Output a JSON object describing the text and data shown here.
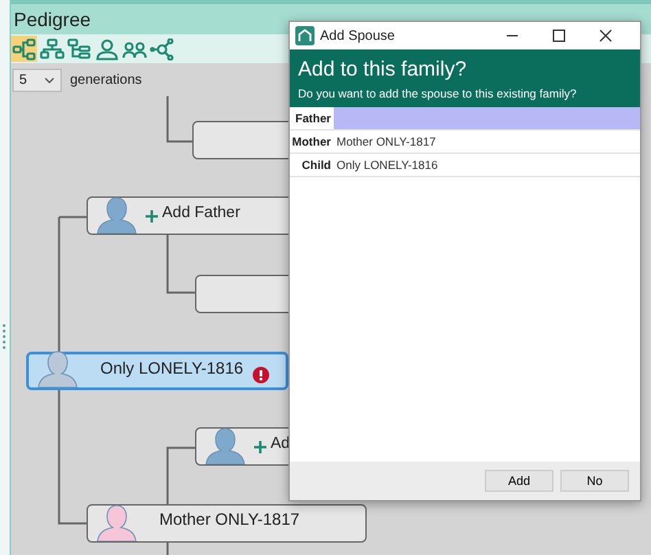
{
  "panel": {
    "title": "Pedigree"
  },
  "tools": [
    {
      "selected": true
    },
    {
      "selected": false
    },
    {
      "selected": false
    },
    {
      "selected": false
    },
    {
      "selected": false
    },
    {
      "selected": false
    }
  ],
  "generations": {
    "value": "5",
    "label": "generations"
  },
  "nodes": [
    {
      "kind": "empty",
      "selected": false
    },
    {
      "kind": "add",
      "label": "Add Father",
      "color": "#7fa9cc",
      "selected": false
    },
    {
      "kind": "empty",
      "selected": false
    },
    {
      "kind": "person",
      "label": "Only LONELY-1816",
      "color": "#b8c8d8",
      "selected": true,
      "warning": true
    },
    {
      "kind": "add",
      "label": "Ad",
      "color": "#7fa9cc",
      "selected": false
    },
    {
      "kind": "person",
      "label": "Mother ONLY-1817",
      "color": "#f6c6d8",
      "selected": false,
      "warning": false
    }
  ],
  "dialog": {
    "title": "Add Spouse",
    "heading": "Add to this family?",
    "subtitle": "Do you want to add the spouse to this existing family?",
    "rows": [
      {
        "label": "Father",
        "selected": true
      },
      {
        "label": "Mother",
        "value": "Mother ONLY-1817",
        "selected": false
      },
      {
        "label": "Child",
        "value": "Only LONELY-1816",
        "selected": false
      }
    ],
    "buttons": [
      "Add",
      "No"
    ]
  }
}
